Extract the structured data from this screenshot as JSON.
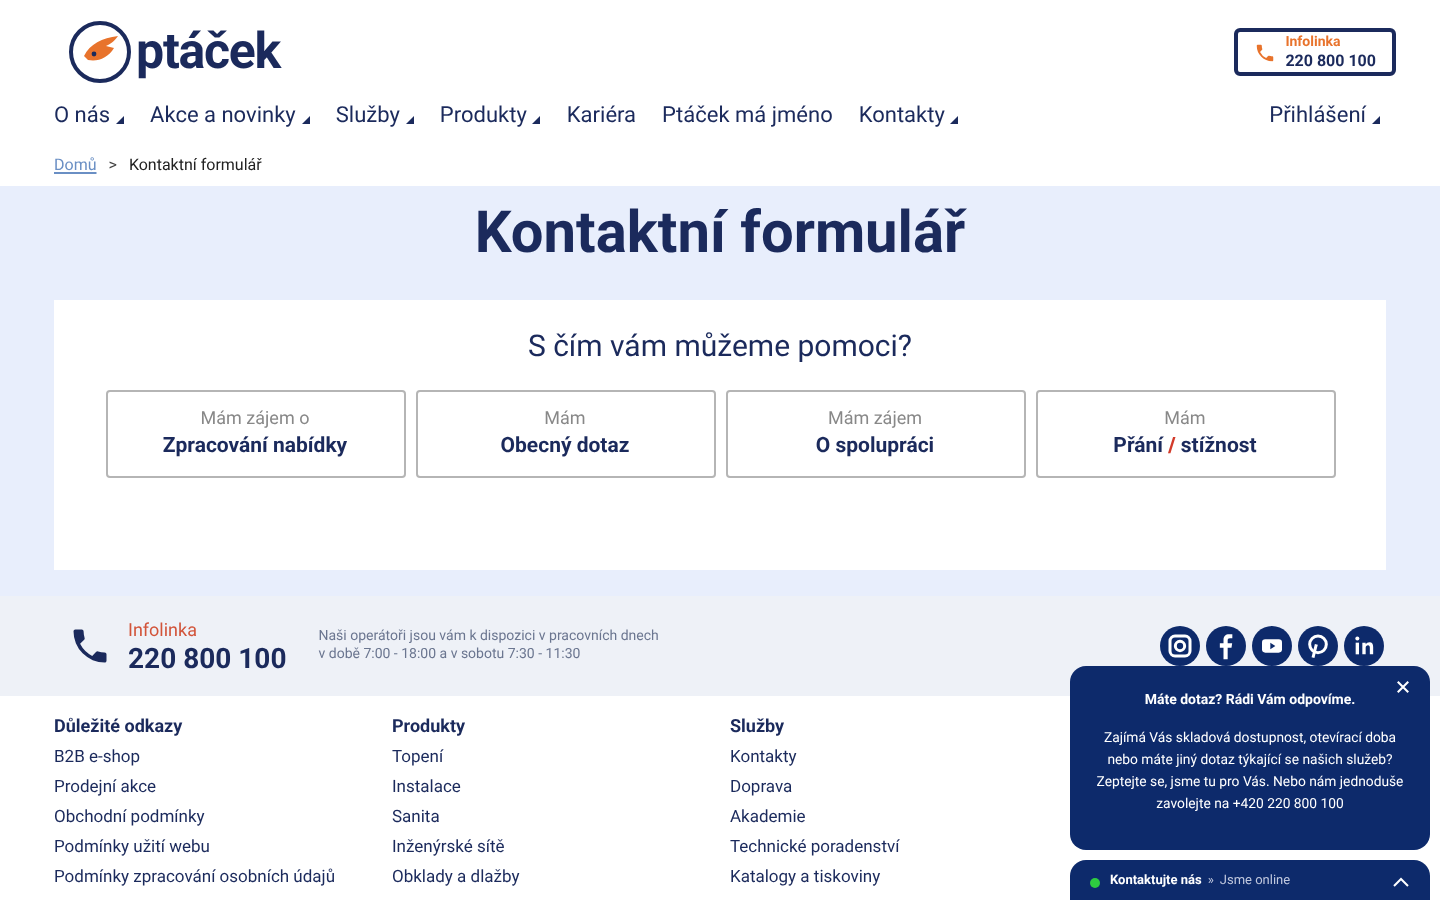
{
  "header": {
    "logo_text": "ptáček",
    "infoline": {
      "label": "Infolinka",
      "phone": "220 800 100"
    }
  },
  "nav": [
    {
      "label": "O nás",
      "dropdown": true
    },
    {
      "label": "Akce a novinky",
      "dropdown": true
    },
    {
      "label": "Služby",
      "dropdown": true
    },
    {
      "label": "Produkty",
      "dropdown": true
    },
    {
      "label": "Kariéra",
      "dropdown": false
    },
    {
      "label": "Ptáček má jméno",
      "dropdown": false
    },
    {
      "label": "Kontakty",
      "dropdown": true
    }
  ],
  "login": {
    "label": "Přihlášení",
    "dropdown": true
  },
  "breadcrumb": [
    {
      "label": "Domů",
      "link": true
    },
    {
      "label": "Kontaktní formulář",
      "link": false
    }
  ],
  "breadcrumb_separator": ">",
  "title": "Kontaktní formulář",
  "form": {
    "question": "S čím vám můžeme pomoci?",
    "options": [
      {
        "pre": "Mám zájem o",
        "main": "Zpracování nabídky"
      },
      {
        "pre": "Mám",
        "main": "Obecný dotaz"
      },
      {
        "pre": "Mám zájem",
        "main": "O spolupráci"
      },
      {
        "pre": "Mám",
        "main": "Přání **/** stížnost"
      }
    ]
  },
  "footer_contact": {
    "label": "Infolinka",
    "phone": "220 800 100",
    "note": [
      "Naši operátoři jsou vám k dispozici v pracovních dnech",
      "v době 7:00 - 18:00 a v sobotu 7:30 - 11:30"
    ]
  },
  "social": [
    {
      "kind": "instagram"
    },
    {
      "kind": "facebook"
    },
    {
      "kind": "youtube"
    },
    {
      "kind": "pinterest"
    },
    {
      "kind": "linkedin"
    }
  ],
  "footer_columns": [
    {
      "heading": "Důležité odkazy",
      "links": [
        "B2B e-shop",
        "Prodejní akce",
        "Obchodní podmínky",
        "Podmínky užití webu",
        "Podmínky zpracování osobních údajů"
      ]
    },
    {
      "heading": "Produkty",
      "links": [
        "Topení",
        "Instalace",
        "Sanita",
        "Inženýrské sítě",
        "Obklady a dlažby"
      ]
    },
    {
      "heading": "Služby",
      "links": [
        "Kontakty",
        "Doprava",
        "Akademie",
        "Technické poradenství",
        "Katalogy a tiskoviny"
      ]
    }
  ],
  "chat_popup": {
    "title": "Máte dotaz? Rádi Vám odpovíme.",
    "body": "Zajímá Vás skladová dostupnost, otevírací doba nebo máte jiný dotaz týkající se našich služeb? Zeptejte se, jsme tu pro Vás. Nebo nám jednoduše zavolejte na +420 220 800 100"
  },
  "chat_bar": {
    "label": "Kontaktujte nás",
    "separator": "»",
    "status": "Jsme online",
    "online": true
  }
}
